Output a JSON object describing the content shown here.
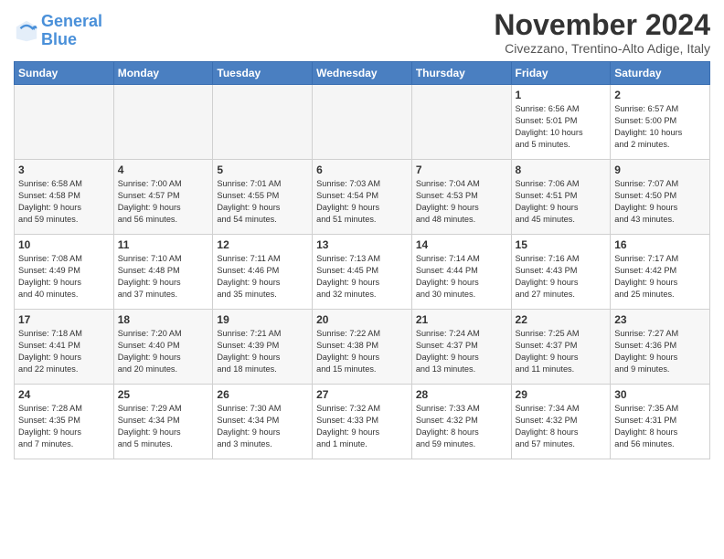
{
  "header": {
    "logo_line1": "General",
    "logo_line2": "Blue",
    "month_title": "November 2024",
    "location": "Civezzano, Trentino-Alto Adige, Italy"
  },
  "weekdays": [
    "Sunday",
    "Monday",
    "Tuesday",
    "Wednesday",
    "Thursday",
    "Friday",
    "Saturday"
  ],
  "weeks": [
    [
      {
        "day": "",
        "info": "",
        "empty": true
      },
      {
        "day": "",
        "info": "",
        "empty": true
      },
      {
        "day": "",
        "info": "",
        "empty": true
      },
      {
        "day": "",
        "info": "",
        "empty": true
      },
      {
        "day": "",
        "info": "",
        "empty": true
      },
      {
        "day": "1",
        "info": "Sunrise: 6:56 AM\nSunset: 5:01 PM\nDaylight: 10 hours\nand 5 minutes."
      },
      {
        "day": "2",
        "info": "Sunrise: 6:57 AM\nSunset: 5:00 PM\nDaylight: 10 hours\nand 2 minutes."
      }
    ],
    [
      {
        "day": "3",
        "info": "Sunrise: 6:58 AM\nSunset: 4:58 PM\nDaylight: 9 hours\nand 59 minutes."
      },
      {
        "day": "4",
        "info": "Sunrise: 7:00 AM\nSunset: 4:57 PM\nDaylight: 9 hours\nand 56 minutes."
      },
      {
        "day": "5",
        "info": "Sunrise: 7:01 AM\nSunset: 4:55 PM\nDaylight: 9 hours\nand 54 minutes."
      },
      {
        "day": "6",
        "info": "Sunrise: 7:03 AM\nSunset: 4:54 PM\nDaylight: 9 hours\nand 51 minutes."
      },
      {
        "day": "7",
        "info": "Sunrise: 7:04 AM\nSunset: 4:53 PM\nDaylight: 9 hours\nand 48 minutes."
      },
      {
        "day": "8",
        "info": "Sunrise: 7:06 AM\nSunset: 4:51 PM\nDaylight: 9 hours\nand 45 minutes."
      },
      {
        "day": "9",
        "info": "Sunrise: 7:07 AM\nSunset: 4:50 PM\nDaylight: 9 hours\nand 43 minutes."
      }
    ],
    [
      {
        "day": "10",
        "info": "Sunrise: 7:08 AM\nSunset: 4:49 PM\nDaylight: 9 hours\nand 40 minutes."
      },
      {
        "day": "11",
        "info": "Sunrise: 7:10 AM\nSunset: 4:48 PM\nDaylight: 9 hours\nand 37 minutes."
      },
      {
        "day": "12",
        "info": "Sunrise: 7:11 AM\nSunset: 4:46 PM\nDaylight: 9 hours\nand 35 minutes."
      },
      {
        "day": "13",
        "info": "Sunrise: 7:13 AM\nSunset: 4:45 PM\nDaylight: 9 hours\nand 32 minutes."
      },
      {
        "day": "14",
        "info": "Sunrise: 7:14 AM\nSunset: 4:44 PM\nDaylight: 9 hours\nand 30 minutes."
      },
      {
        "day": "15",
        "info": "Sunrise: 7:16 AM\nSunset: 4:43 PM\nDaylight: 9 hours\nand 27 minutes."
      },
      {
        "day": "16",
        "info": "Sunrise: 7:17 AM\nSunset: 4:42 PM\nDaylight: 9 hours\nand 25 minutes."
      }
    ],
    [
      {
        "day": "17",
        "info": "Sunrise: 7:18 AM\nSunset: 4:41 PM\nDaylight: 9 hours\nand 22 minutes."
      },
      {
        "day": "18",
        "info": "Sunrise: 7:20 AM\nSunset: 4:40 PM\nDaylight: 9 hours\nand 20 minutes."
      },
      {
        "day": "19",
        "info": "Sunrise: 7:21 AM\nSunset: 4:39 PM\nDaylight: 9 hours\nand 18 minutes."
      },
      {
        "day": "20",
        "info": "Sunrise: 7:22 AM\nSunset: 4:38 PM\nDaylight: 9 hours\nand 15 minutes."
      },
      {
        "day": "21",
        "info": "Sunrise: 7:24 AM\nSunset: 4:37 PM\nDaylight: 9 hours\nand 13 minutes."
      },
      {
        "day": "22",
        "info": "Sunrise: 7:25 AM\nSunset: 4:37 PM\nDaylight: 9 hours\nand 11 minutes."
      },
      {
        "day": "23",
        "info": "Sunrise: 7:27 AM\nSunset: 4:36 PM\nDaylight: 9 hours\nand 9 minutes."
      }
    ],
    [
      {
        "day": "24",
        "info": "Sunrise: 7:28 AM\nSunset: 4:35 PM\nDaylight: 9 hours\nand 7 minutes."
      },
      {
        "day": "25",
        "info": "Sunrise: 7:29 AM\nSunset: 4:34 PM\nDaylight: 9 hours\nand 5 minutes."
      },
      {
        "day": "26",
        "info": "Sunrise: 7:30 AM\nSunset: 4:34 PM\nDaylight: 9 hours\nand 3 minutes."
      },
      {
        "day": "27",
        "info": "Sunrise: 7:32 AM\nSunset: 4:33 PM\nDaylight: 9 hours\nand 1 minute."
      },
      {
        "day": "28",
        "info": "Sunrise: 7:33 AM\nSunset: 4:32 PM\nDaylight: 8 hours\nand 59 minutes."
      },
      {
        "day": "29",
        "info": "Sunrise: 7:34 AM\nSunset: 4:32 PM\nDaylight: 8 hours\nand 57 minutes."
      },
      {
        "day": "30",
        "info": "Sunrise: 7:35 AM\nSunset: 4:31 PM\nDaylight: 8 hours\nand 56 minutes."
      }
    ]
  ]
}
